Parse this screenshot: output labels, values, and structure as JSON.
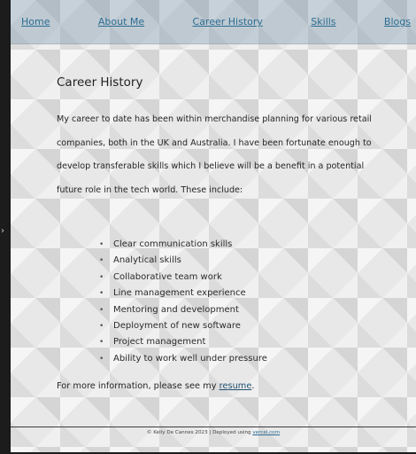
{
  "nav": {
    "items": [
      {
        "label": "Home"
      },
      {
        "label": "About Me"
      },
      {
        "label": "Career History"
      },
      {
        "label": "Skills"
      },
      {
        "label": "Blogs"
      }
    ]
  },
  "main": {
    "title": "Career History",
    "intro": "My career to date has been within merchandise planning for various retail companies, both in the UK and Australia. I have been fortunate enough to develop transferable skills which I believe will be a benefit in a potential future role in the tech world. These include:",
    "skills": [
      "Clear communication skills",
      "Analytical skills",
      "Collaborative team work",
      "Line management experience",
      "Mentoring and development",
      "Deployment of new software",
      "Project management",
      "Ability to work well under pressure"
    ],
    "more_prefix": "For more information, please see my ",
    "more_link": "resume",
    "more_suffix": "."
  },
  "footer": {
    "text": "© Kelly De Cannes 2023 | Deployed using ",
    "link": "vercel.com"
  },
  "icons": {
    "side_arrow": "chevron-right-icon"
  }
}
